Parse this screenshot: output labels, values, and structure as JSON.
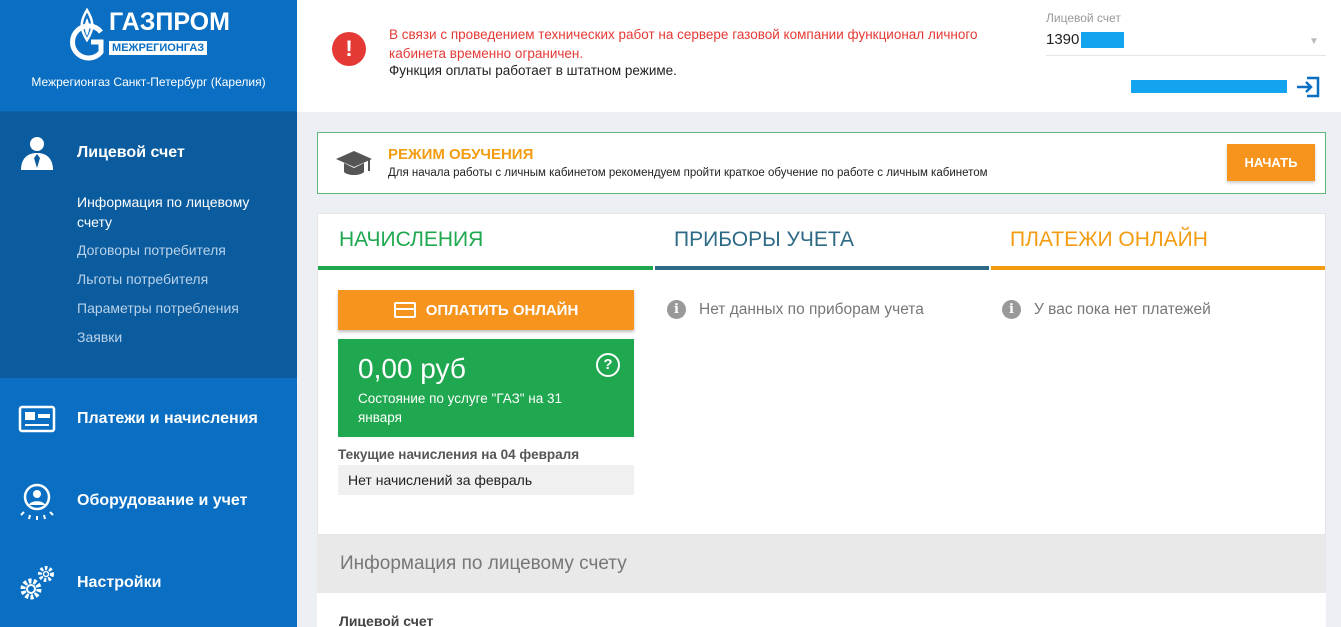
{
  "brand": {
    "logo_main": "ГАЗПРОМ",
    "logo_sub": "МЕЖРЕГИОНГАЗ",
    "region": "Межрегионгаз Санкт-Петербург (Карелия)"
  },
  "sidebar": {
    "account_section": {
      "title": "Лицевой счет",
      "items": [
        {
          "label": "Информация по лицевому счету",
          "active": true
        },
        {
          "label": "Договоры потребителя"
        },
        {
          "label": "Льготы потребителя"
        },
        {
          "label": "Параметры потребления"
        },
        {
          "label": "Заявки"
        }
      ]
    },
    "items": [
      {
        "label": "Платежи и начисления",
        "icon": "payments-icon"
      },
      {
        "label": "Оборудование и учет",
        "icon": "equipment-icon"
      },
      {
        "label": "Настройки",
        "icon": "settings-icon"
      }
    ]
  },
  "header": {
    "alert_red": "В связи с проведением технических работ на сервере газовой компании функционал личного кабинета временно ограничен.",
    "alert_black": "Функция оплаты работает в штатном режиме.",
    "account_label": "Лицевой счет",
    "account_value": "1390"
  },
  "training": {
    "title": "РЕЖИМ ОБУЧЕНИЯ",
    "text": "Для начала работы с личным кабинетом рекомендуем пройти краткое обучение по работе с личным кабинетом",
    "button": "НАЧАТЬ"
  },
  "tabs": [
    {
      "label": "НАЧИСЛЕНИЯ",
      "color": "#1fa84f"
    },
    {
      "label": "ПРИБОРЫ УЧЕТА",
      "color": "#2e6a86"
    },
    {
      "label": "ПЛАТЕЖИ ОНЛАЙН",
      "color": "#f39c12"
    }
  ],
  "charges": {
    "pay_button": "ОПЛАТИТЬ ОНЛАЙН",
    "balance_amount": "0,00 руб",
    "balance_desc": "Состояние по услуге \"ГАЗ\" на 31 января",
    "current_label": "Текущие начисления на 04 февраля",
    "current_value": "Нет начислений за февраль"
  },
  "meters": {
    "message": "Нет данных по приборам учета"
  },
  "payments": {
    "message": "У вас пока нет платежей"
  },
  "info_section": {
    "title": "Информация по лицевому счету",
    "first_label": "Лицевой счет"
  },
  "colors": {
    "sidebar": "#0a6fc2",
    "sidebar_active": "#0a5c9f",
    "accent_orange": "#f7941d",
    "success_green": "#1fa84f",
    "alert_red": "#e53935"
  }
}
